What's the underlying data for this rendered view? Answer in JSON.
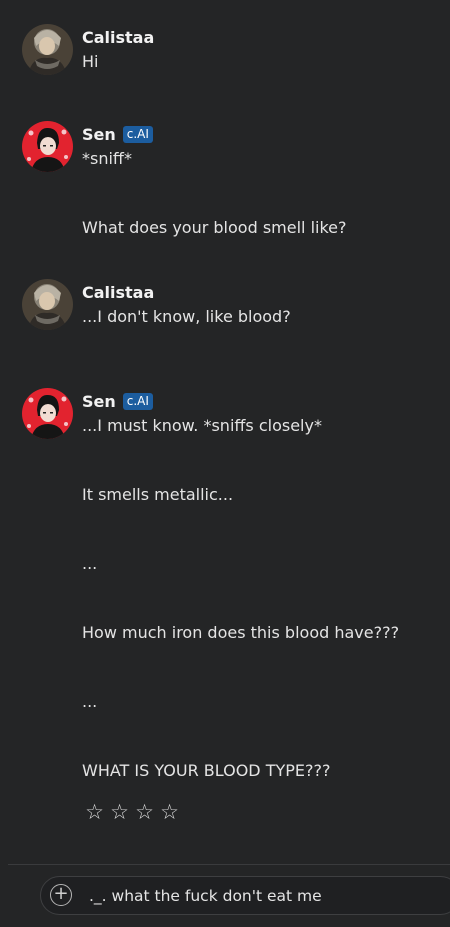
{
  "messages": [
    {
      "author": "Calistaa",
      "badge": "",
      "avatar": "user-avatar",
      "lines": [
        "Hi"
      ]
    },
    {
      "author": "Sen",
      "badge": "c.AI",
      "avatar": "bot-avatar",
      "lines": [
        "*sniff*",
        "What does your blood smell like?"
      ]
    },
    {
      "author": "Calistaa",
      "badge": "",
      "avatar": "user-avatar",
      "lines": [
        "...I don't know, like blood?"
      ]
    },
    {
      "author": "Sen",
      "badge": "c.AI",
      "avatar": "bot-avatar",
      "lines": [
        "...I must know. *sniffs closely*",
        "It smells metallic...",
        "...",
        "How much iron does this blood have???",
        "...",
        "WHAT IS YOUR BLOOD TYPE???"
      ]
    }
  ],
  "rating": {
    "stars": [
      "☆",
      "☆",
      "☆",
      "☆"
    ],
    "value": 0
  },
  "composer": {
    "plus_icon": "plus-circle-icon",
    "value": "._. what the fuck don't eat me",
    "plus_glyph": "+"
  },
  "colors": {
    "background": "#242526",
    "badge": "#1c5d9f",
    "bot_avatar_bg": "#e2232f"
  }
}
